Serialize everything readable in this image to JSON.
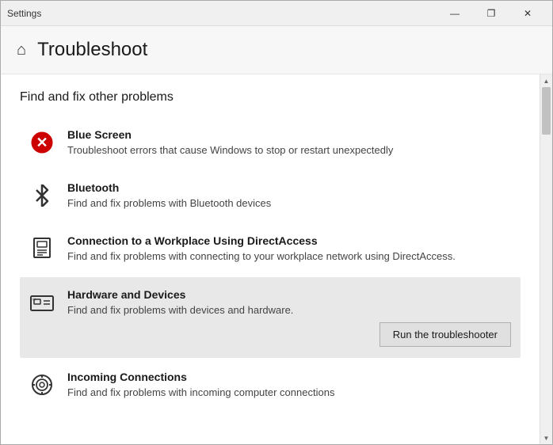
{
  "window": {
    "title": "Settings",
    "controls": {
      "minimize": "—",
      "maximize": "❐",
      "close": "✕"
    }
  },
  "header": {
    "icon": "⌂",
    "title": "Troubleshoot"
  },
  "main": {
    "section_title": "Find and fix other problems",
    "items": [
      {
        "id": "blue-screen",
        "name": "Blue Screen",
        "description": "Troubleshoot errors that cause Windows to stop or restart unexpectedly",
        "icon_type": "bluescreen",
        "selected": false
      },
      {
        "id": "bluetooth",
        "name": "Bluetooth",
        "description": "Find and fix problems with Bluetooth devices",
        "icon_type": "bluetooth",
        "selected": false
      },
      {
        "id": "directaccess",
        "name": "Connection to a Workplace Using DirectAccess",
        "description": "Find and fix problems with connecting to your workplace network using DirectAccess.",
        "icon_type": "directaccess",
        "selected": false
      },
      {
        "id": "hardware-devices",
        "name": "Hardware and Devices",
        "description": "Find and fix problems with devices and hardware.",
        "icon_type": "hardware",
        "selected": true,
        "button_label": "Run the troubleshooter"
      },
      {
        "id": "incoming-connections",
        "name": "Incoming Connections",
        "description": "Find and fix problems with incoming computer connections",
        "icon_type": "incoming",
        "selected": false
      }
    ]
  }
}
